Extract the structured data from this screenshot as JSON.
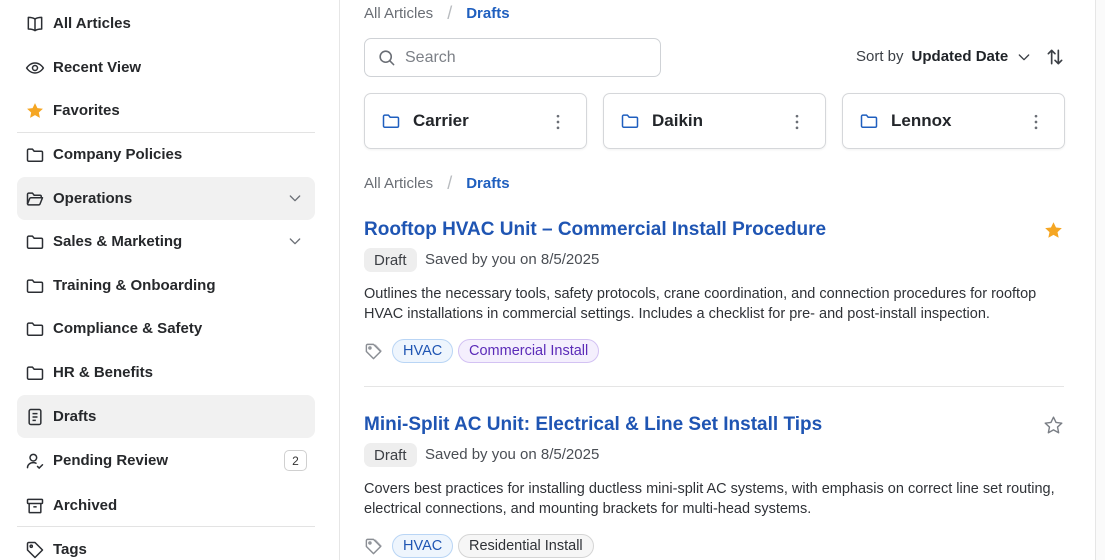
{
  "sidebar": {
    "items": [
      {
        "label": "All Articles",
        "icon": "book-open-icon"
      },
      {
        "label": "Recent View",
        "icon": "eye-icon"
      },
      {
        "label": "Favorites",
        "icon": "star-icon"
      },
      {
        "label": "Company Policies",
        "icon": "folder-icon"
      },
      {
        "label": "Operations",
        "icon": "folder-open-icon"
      },
      {
        "label": "Sales & Marketing",
        "icon": "folder-icon"
      },
      {
        "label": "Training & Onboarding",
        "icon": "folder-icon"
      },
      {
        "label": "Compliance & Safety",
        "icon": "folder-icon"
      },
      {
        "label": "HR & Benefits",
        "icon": "folder-icon"
      },
      {
        "label": "Drafts",
        "icon": "document-icon"
      },
      {
        "label": "Pending Review",
        "icon": "user-clock-icon",
        "badge": "2"
      },
      {
        "label": "Archived",
        "icon": "archive-icon"
      },
      {
        "label": "Tags",
        "icon": "tag-icon"
      }
    ],
    "active": "Drafts"
  },
  "breadcrumb": {
    "root": "All Articles",
    "separator": "/",
    "current": "Drafts"
  },
  "search": {
    "placeholder": "Search",
    "value": ""
  },
  "sort": {
    "label": "Sort by",
    "value": "Updated Date"
  },
  "folders": [
    {
      "name": "Carrier"
    },
    {
      "name": "Daikin"
    },
    {
      "name": "Lennox"
    }
  ],
  "articles": [
    {
      "title": "Rooftop HVAC Unit – Commercial Install Procedure",
      "status": "Draft",
      "saved": "Saved by you on 8/5/2025",
      "description": "Outlines the necessary tools, safety protocols, crane coordination, and connection procedures for rooftop HVAC installations in commercial settings. Includes a checklist for pre- and post-install inspection.",
      "tags": [
        "HVAC",
        "Commercial Install"
      ],
      "favorited": true
    },
    {
      "title": "Mini-Split AC Unit: Electrical & Line Set Install Tips",
      "status": "Draft",
      "saved": "Saved by you on 8/5/2025",
      "description": "Covers best practices for installing ductless mini-split AC systems, with emphasis on correct line set routing, electrical connections, and mounting brackets for multi-head systems.",
      "tags": [
        "HVAC",
        "Residential Install"
      ],
      "favorited": false
    }
  ],
  "colors": {
    "accent": "#1f55b3",
    "star": "#f5a623",
    "active_bg": "#f1f1f1"
  }
}
